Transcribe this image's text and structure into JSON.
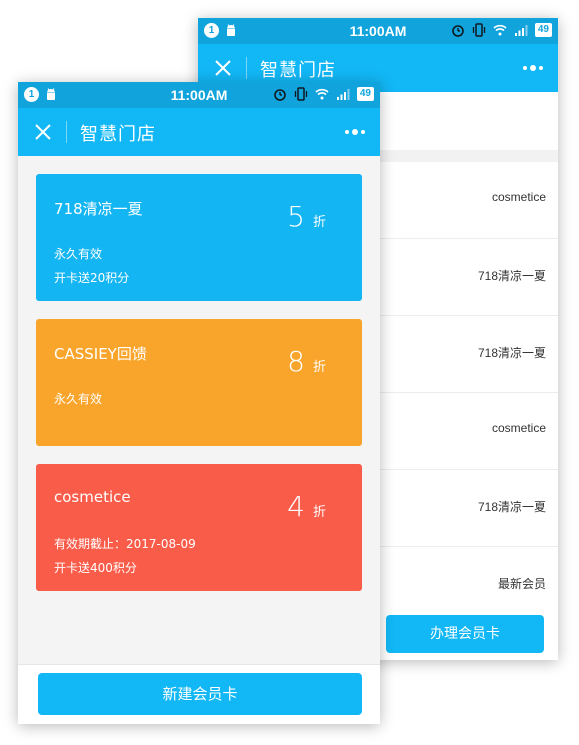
{
  "status_bar": {
    "notification_count": "1",
    "time": "11:00AM",
    "battery": "49"
  },
  "header": {
    "title": "智慧门店"
  },
  "back_screen": {
    "rows": [
      {
        "label": "cosmetice"
      },
      {
        "label": "718清凉一夏"
      },
      {
        "label": "718清凉一夏"
      },
      {
        "label": "cosmetice"
      },
      {
        "label": "718清凉一夏"
      },
      {
        "label": "最新会员"
      }
    ],
    "action_button": "办理会员卡"
  },
  "cards": [
    {
      "name": "718清凉一夏",
      "discount": "5",
      "unit": "折",
      "line1": "永久有效",
      "line2": "开卡送20积分",
      "color": "#13b5f3"
    },
    {
      "name": "CASSIEY回馈",
      "discount": "8",
      "unit": "折",
      "line1": "永久有效",
      "line2": "",
      "color": "#f9a52c"
    },
    {
      "name": "cosmetice",
      "discount": "4",
      "unit": "折",
      "line1": "有效期截止：2017-08-09",
      "line2": "开卡送400积分",
      "color": "#fa5c4a"
    }
  ],
  "footer": {
    "new_card_button": "新建会员卡"
  },
  "colors": {
    "accent": "#12b7f5",
    "status_bar": "#10a3dc"
  },
  "icons": [
    "notification-icon",
    "android-icon",
    "alarm-icon",
    "vibrate-icon",
    "wifi-icon",
    "signal-icon",
    "battery-icon",
    "close-icon",
    "more-icon"
  ]
}
